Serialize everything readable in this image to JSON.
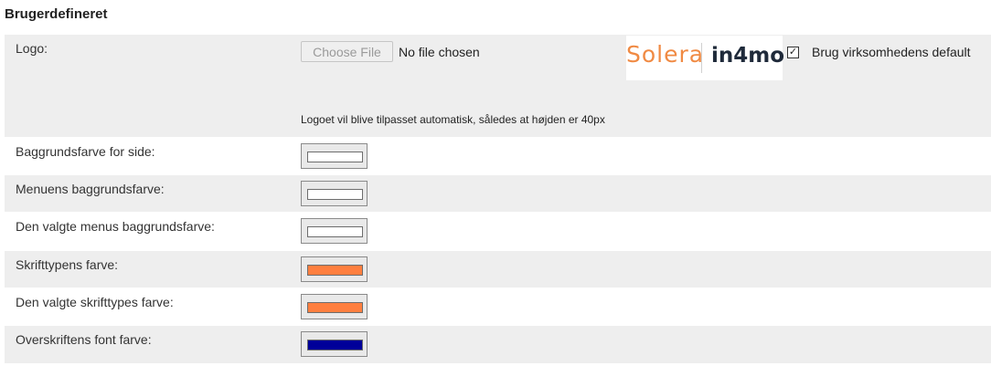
{
  "section": {
    "title": "Brugerdefineret"
  },
  "logo_row": {
    "label": "Logo:",
    "choose_file_label": "Choose File",
    "no_file_text": "No file chosen",
    "logo_brand_left": "Solera",
    "logo_brand_right": "in4mo",
    "default_checkbox_label": "Brug virksomhedens default",
    "default_checked": true,
    "hint": "Logoet vil blive tilpasset automatisk, således at højden er 40px"
  },
  "color_rows": [
    {
      "label": "Baggrundsfarve for side:",
      "color": "#ffffff"
    },
    {
      "label": "Menuens baggrundsfarve:",
      "color": "#ffffff"
    },
    {
      "label": "Den valgte menus baggrundsfarve:",
      "color": "#ffffff"
    },
    {
      "label": "Skrifttypens farve:",
      "color": "#ff7f3f"
    },
    {
      "label": "Den valgte skrifttypes farve:",
      "color": "#ff7f3f"
    },
    {
      "label": "Overskriftens font farve:",
      "color": "#000099"
    }
  ]
}
